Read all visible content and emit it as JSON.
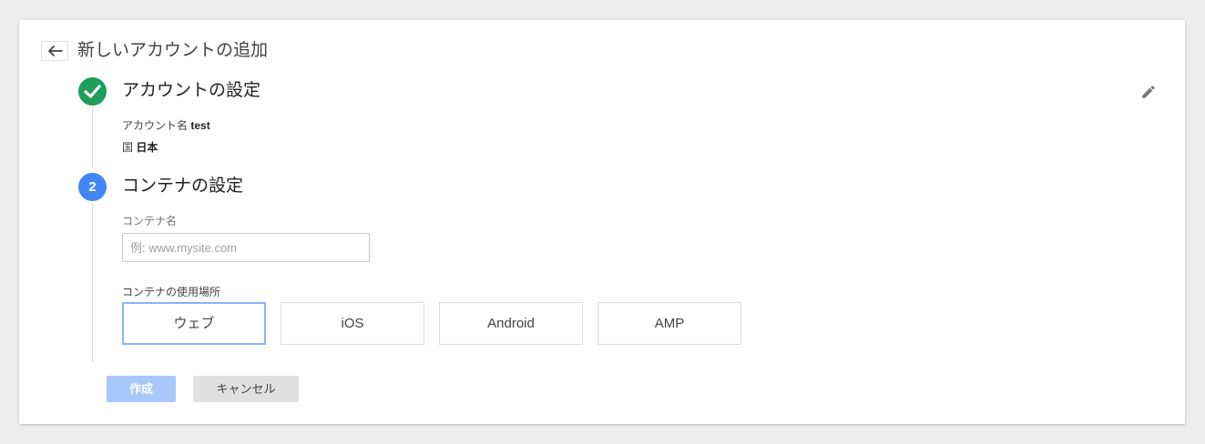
{
  "header": {
    "title": "新しいアカウントの追加"
  },
  "step1": {
    "title": "アカウントの設定",
    "account_label": "アカウント名",
    "account_value": "test",
    "country_label": "国",
    "country_value": "日本"
  },
  "step2": {
    "number": "2",
    "title": "コンテナの設定",
    "container_name_label": "コンテナ名",
    "container_name_placeholder": "例: www.mysite.com",
    "container_name_value": "",
    "usage_label": "コンテナの使用場所",
    "platforms": [
      {
        "label": "ウェブ",
        "selected": true
      },
      {
        "label": "iOS",
        "selected": false
      },
      {
        "label": "Android",
        "selected": false
      },
      {
        "label": "AMP",
        "selected": false
      }
    ]
  },
  "actions": {
    "create_label": "作成",
    "cancel_label": "キャンセル"
  },
  "colors": {
    "done_green": "#1e9e5a",
    "active_blue": "#4285f4",
    "create_disabled": "#a8c7fa",
    "selected_border": "#8ab4f8"
  },
  "icons": {
    "back": "arrow-back-icon",
    "done": "check-icon",
    "edit": "pencil-icon"
  }
}
